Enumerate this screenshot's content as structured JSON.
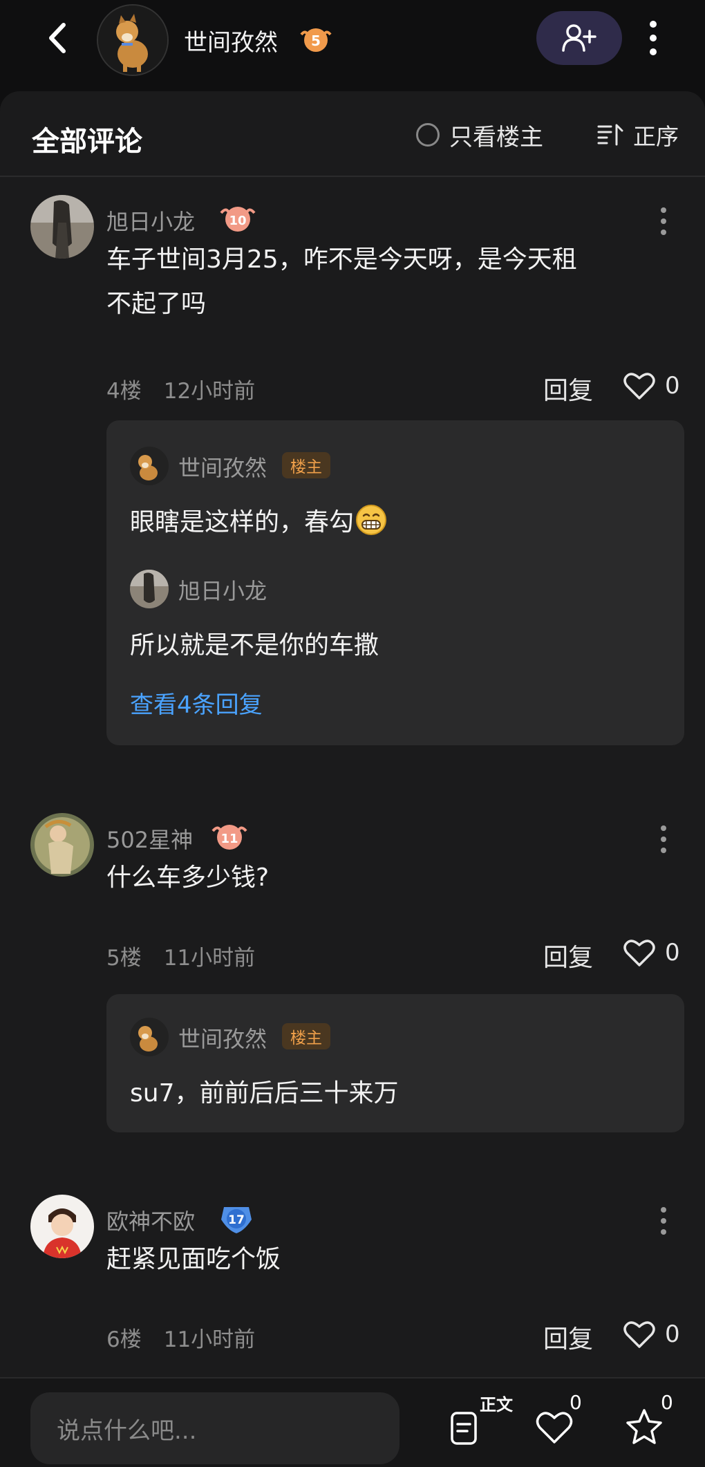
{
  "header": {
    "user_name": "世间孜然",
    "level": "5",
    "level_color": "#f19a4b"
  },
  "toolbar": {
    "title": "全部评论",
    "only_op_label": "只看楼主",
    "order_label": "正序"
  },
  "comments": [
    {
      "user": "旭日小龙",
      "level": "10",
      "level_color": "#f29a86",
      "text_line1": "车子世间3月25，咋不是今天呀，是今天租",
      "text_line2": "不起了吗",
      "floor": "4楼",
      "time": "12小时前",
      "reply_label": "回复",
      "likes": "0",
      "replies": [
        {
          "user": "世间孜然",
          "tag": "楼主",
          "text": "眼瞎是这样的，春勾"
        },
        {
          "user": "旭日小龙",
          "text": "所以就是不是你的车撒"
        }
      ],
      "more_replies": "查看4条回复"
    },
    {
      "user": "502星神",
      "level": "11",
      "level_color": "#f29a86",
      "text_line1": "什么车多少钱?",
      "floor": "5楼",
      "time": "11小时前",
      "reply_label": "回复",
      "likes": "0",
      "replies": [
        {
          "user": "世间孜然",
          "tag": "楼主",
          "text": "su7，前前后后三十来万"
        }
      ]
    },
    {
      "user": "欧神不欧",
      "level": "17",
      "level_color": "#4f8fe6",
      "text_line1": "赶紧见面吃个饭",
      "floor": "6楼",
      "time": "11小时前",
      "reply_label": "回复",
      "likes": "0"
    }
  ],
  "bottom": {
    "input_placeholder": "说点什么吧...",
    "doc_label": "正文",
    "like_count": "0",
    "fav_count": "0"
  }
}
